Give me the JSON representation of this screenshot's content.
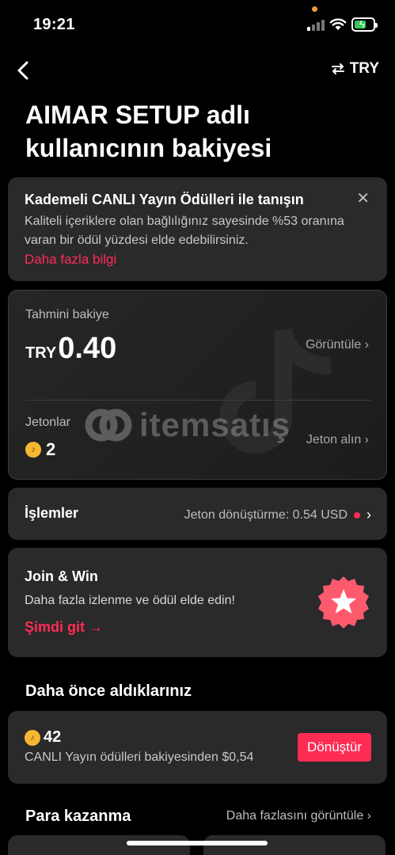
{
  "status": {
    "time": "19:21"
  },
  "nav": {
    "currency_label": "TRY"
  },
  "title": "AIMAR SETUP adlı kullanıcının bakiyesi",
  "promo": {
    "title": "Kademeli CANLI Yayın Ödülleri ile tanışın",
    "text": "Kaliteli içeriklere olan bağlılığınız sayesinde %53 oranına varan bir ödül yüzdesi elde edebilirsiniz.",
    "link": "Daha fazla bilgi"
  },
  "balance": {
    "label": "Tahmini bakiye",
    "currency": "TRY",
    "amount": "0.40",
    "view_label": "Görüntüle ›",
    "coins_label": "Jetonlar",
    "coins": "2",
    "get_coins_label": "Jeton alın ›",
    "watermark": "itemsatış"
  },
  "transactions": {
    "title": "İşlemler",
    "info": "Jeton dönüştürme: 0.54 USD"
  },
  "join_win": {
    "title": "Join & Win",
    "subtitle": "Daha fazla izlenme ve ödül elde edin!",
    "link": "Şimdi git →"
  },
  "received": {
    "section_title": "Daha önce aldıklarınız",
    "amount": "42",
    "subtitle": "CANLI Yayın ödülleri bakiyesinden $0,54",
    "button": "Dönüştür"
  },
  "earn": {
    "section_title": "Para kazanma",
    "more_link": "Daha fazlasını görüntüle ›"
  },
  "colors": {
    "accent": "#fe2c55",
    "card": "#2a2a2a",
    "coin": "#f7b733"
  }
}
